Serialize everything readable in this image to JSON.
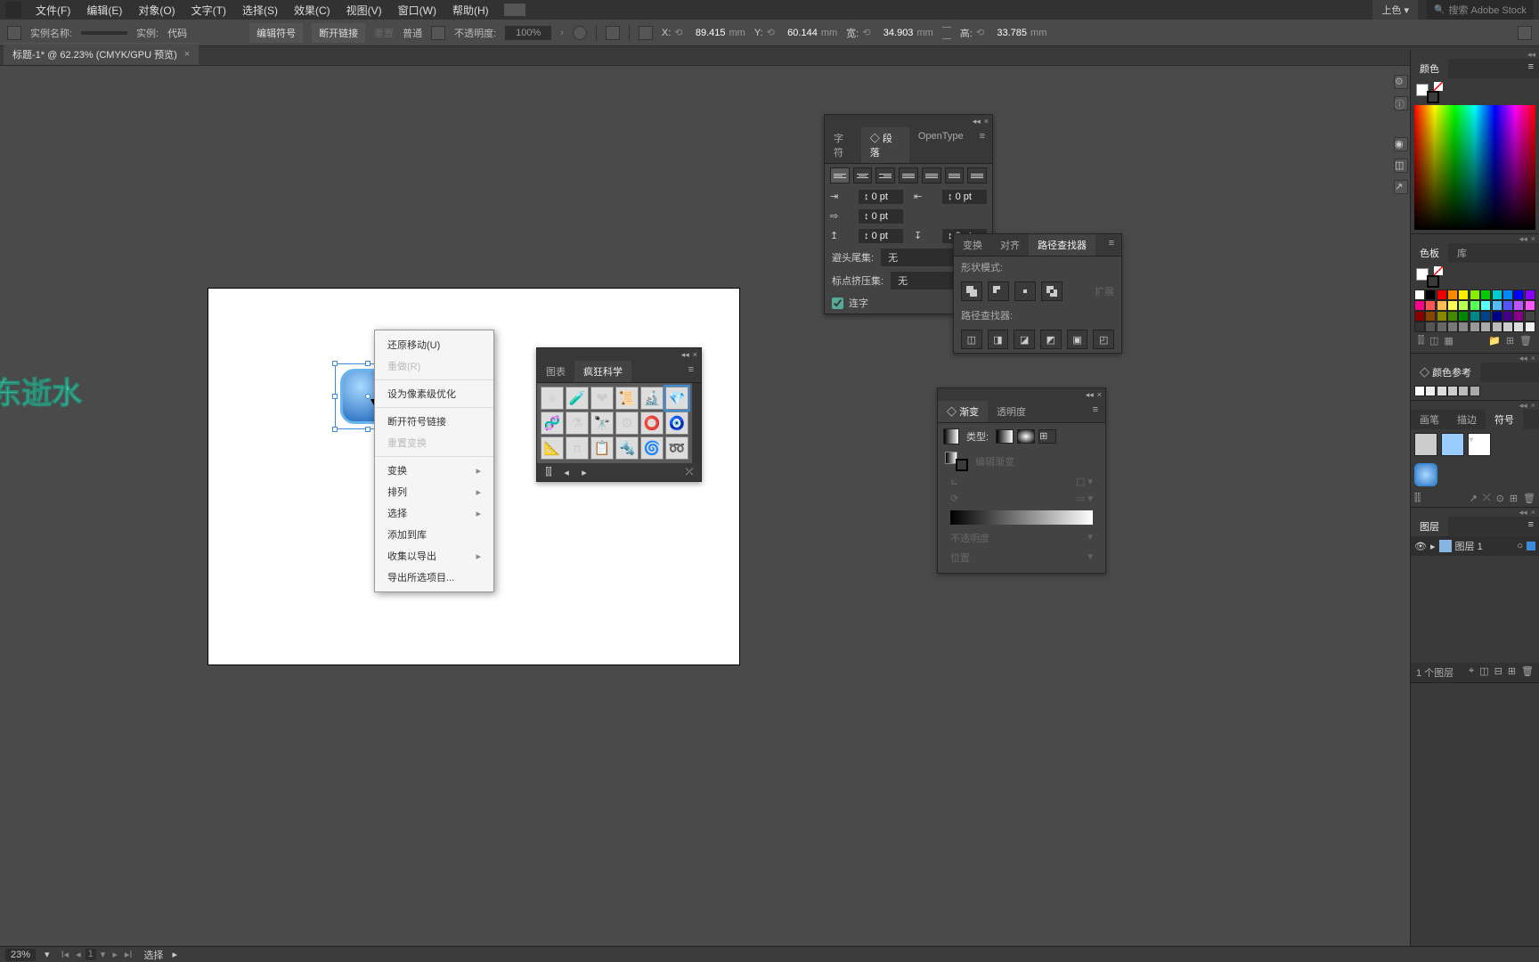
{
  "menu": {
    "items": [
      "文件(F)",
      "编辑(E)",
      "对象(O)",
      "文字(T)",
      "选择(S)",
      "效果(C)",
      "视图(V)",
      "窗口(W)",
      "帮助(H)"
    ],
    "top_btn": "上色",
    "search_ph": "搜索 Adobe Stock"
  },
  "optbar": {
    "name_lbl": "实例名称:",
    "name_val": "",
    "inst_lbl": "实例:",
    "inst_val": "代码",
    "edit_btn": "编辑符号",
    "break_btn": "断开链接",
    "reset_btn": "重置",
    "blend_lbl": "普通",
    "opacity_lbl": "不透明度:",
    "opacity_val": "100%",
    "x_lbl": "X:",
    "x_val": "89.415",
    "x_unit": "mm",
    "y_lbl": "Y:",
    "y_val": "60.144",
    "y_unit": "mm",
    "w_lbl": "宽:",
    "w_val": "34.903",
    "w_unit": "mm",
    "h_lbl": "高:",
    "h_val": "33.785",
    "h_unit": "mm"
  },
  "tab": {
    "title": "标题-1* @ 62.23% (CMYK/GPU 预览)"
  },
  "watermark": "东逝水",
  "ctx": {
    "items": [
      {
        "t": "还原移动(U)",
        "d": false
      },
      {
        "t": "重做(R)",
        "d": true
      },
      {
        "sep": true
      },
      {
        "t": "设为像素级优化",
        "d": false
      },
      {
        "sep": true
      },
      {
        "t": "断开符号链接",
        "d": false
      },
      {
        "t": "重置变换",
        "d": true
      },
      {
        "sep": true
      },
      {
        "t": "变换",
        "d": false,
        "arr": true
      },
      {
        "t": "排列",
        "d": false,
        "arr": true
      },
      {
        "t": "选择",
        "d": false,
        "arr": true
      },
      {
        "t": "添加到库",
        "d": false
      },
      {
        "t": "收集以导出",
        "d": false,
        "arr": true
      },
      {
        "t": "导出所选项目...",
        "d": false
      }
    ]
  },
  "para": {
    "tabs": [
      "字符",
      "段落",
      "OpenType"
    ],
    "active": 1,
    "left_indent": "0 pt",
    "right_indent": "0 pt",
    "first_indent": "0 pt",
    "space_before": "0 pt",
    "space_after": "0 pt",
    "widow_lbl": "避头尾集:",
    "widow_val": "无",
    "spacing_lbl": "标点挤压集:",
    "spacing_val": "无",
    "hyph": "连字"
  },
  "pathf": {
    "tabs": [
      "变换",
      "对齐",
      "路径查找器"
    ],
    "active": 2,
    "shape_lbl": "形状模式:",
    "expand": "扩展",
    "pf_lbl": "路径查找器:"
  },
  "grad": {
    "tabs": [
      "渐变",
      "透明度"
    ],
    "active": 0,
    "type_lbl": "类型:",
    "edit_lbl": "编辑渐变",
    "angle_lbl": "角度",
    "ratio_lbl": "长宽比",
    "opac_lbl": "不透明度",
    "loc_lbl": "位置"
  },
  "symlib": {
    "tabs": [
      "图表",
      "疯狂科学"
    ],
    "active": 1,
    "cells": [
      "⚛",
      "🧪",
      "❤",
      "📜",
      "🔬",
      "💎",
      "🧬",
      "⚗",
      "🔭",
      "⚙",
      "⭕",
      "🧿",
      "📐",
      "π",
      "📋",
      "🔩",
      "🌀",
      "➿"
    ],
    "sel": 5
  },
  "rp": {
    "color_tab": "颜色",
    "sw_tabs": [
      "色板",
      "库"
    ],
    "sw_colors": [
      "#fff",
      "#000",
      "#e00",
      "#f80",
      "#fe0",
      "#8e0",
      "#0c0",
      "#0cc",
      "#08f",
      "#00f",
      "#80f",
      "#f08",
      "#f55",
      "#fb5",
      "#ff5",
      "#bf5",
      "#5f5",
      "#5ff",
      "#5bf",
      "#55f",
      "#b5f",
      "#f5f",
      "#800",
      "#840",
      "#880",
      "#480",
      "#080",
      "#088",
      "#048",
      "#008",
      "#408",
      "#808",
      "#444",
      "#333",
      "#555",
      "#666",
      "#777",
      "#888",
      "#999",
      "#aaa",
      "#bbb",
      "#ccc",
      "#ddd",
      "#eee"
    ],
    "cref_tab": "颜色参考",
    "brush_tabs": [
      "画笔",
      "描边",
      "符号"
    ],
    "brush_active": 2,
    "layer_tab": "图层",
    "layer_name": "图层 1",
    "layer_count": "1 个图层"
  },
  "status": {
    "zoom": "23%",
    "page": "1",
    "tool": "选择"
  }
}
